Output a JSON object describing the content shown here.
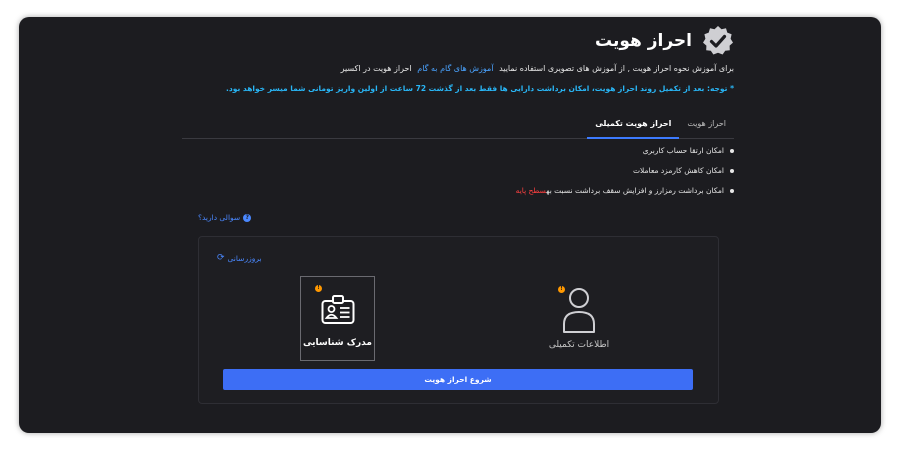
{
  "header": {
    "title": "احراز هویت",
    "badge_icon": "check-badge-icon"
  },
  "intro": {
    "text_before": "برای آموزش نحوه احراز هویت , از آموزش های تصویری استفاده نمایید",
    "link": "آموزش های گام به گام",
    "text_after": "احراز هویت در اکسیر"
  },
  "note": "* توجه: بعد از تکمیل روند احراز هویت، امکان برداشت دارایی ها فقط بعد از گذشت 72 ساعت از اولین واریز تومانی شما میسر خواهد بود.",
  "tabs": [
    {
      "label": "احراز هویت",
      "active": false
    },
    {
      "label": "احراز هویت تکمیلی",
      "active": true
    }
  ],
  "benefits": {
    "item1": "امکان ارتقا حساب کاربری",
    "item2": "امکان کاهش کارمزد معاملات",
    "item3_text": "امکان برداشت رمزارز و افزایش سقف برداشت نسبت به",
    "item3_highlight": "سطح پایه"
  },
  "help_link": "سوالی دارید؟",
  "card": {
    "refresh_label": "بروزرسانی",
    "document": {
      "label": "مدرک شناسایی",
      "icon": "id-card-icon",
      "status_icon": "warning-icon"
    },
    "info": {
      "label": "اطلاعات تکمیلی",
      "icon": "user-icon",
      "status_icon": "warning-icon"
    },
    "start_button": "شروع احراز هویت"
  },
  "colors": {
    "accent": "#3d6ef5",
    "link": "#4a88ff",
    "note": "#29b6f6",
    "warning": "#ff9800",
    "highlight": "#ff4040",
    "background": "#1c1c20"
  }
}
